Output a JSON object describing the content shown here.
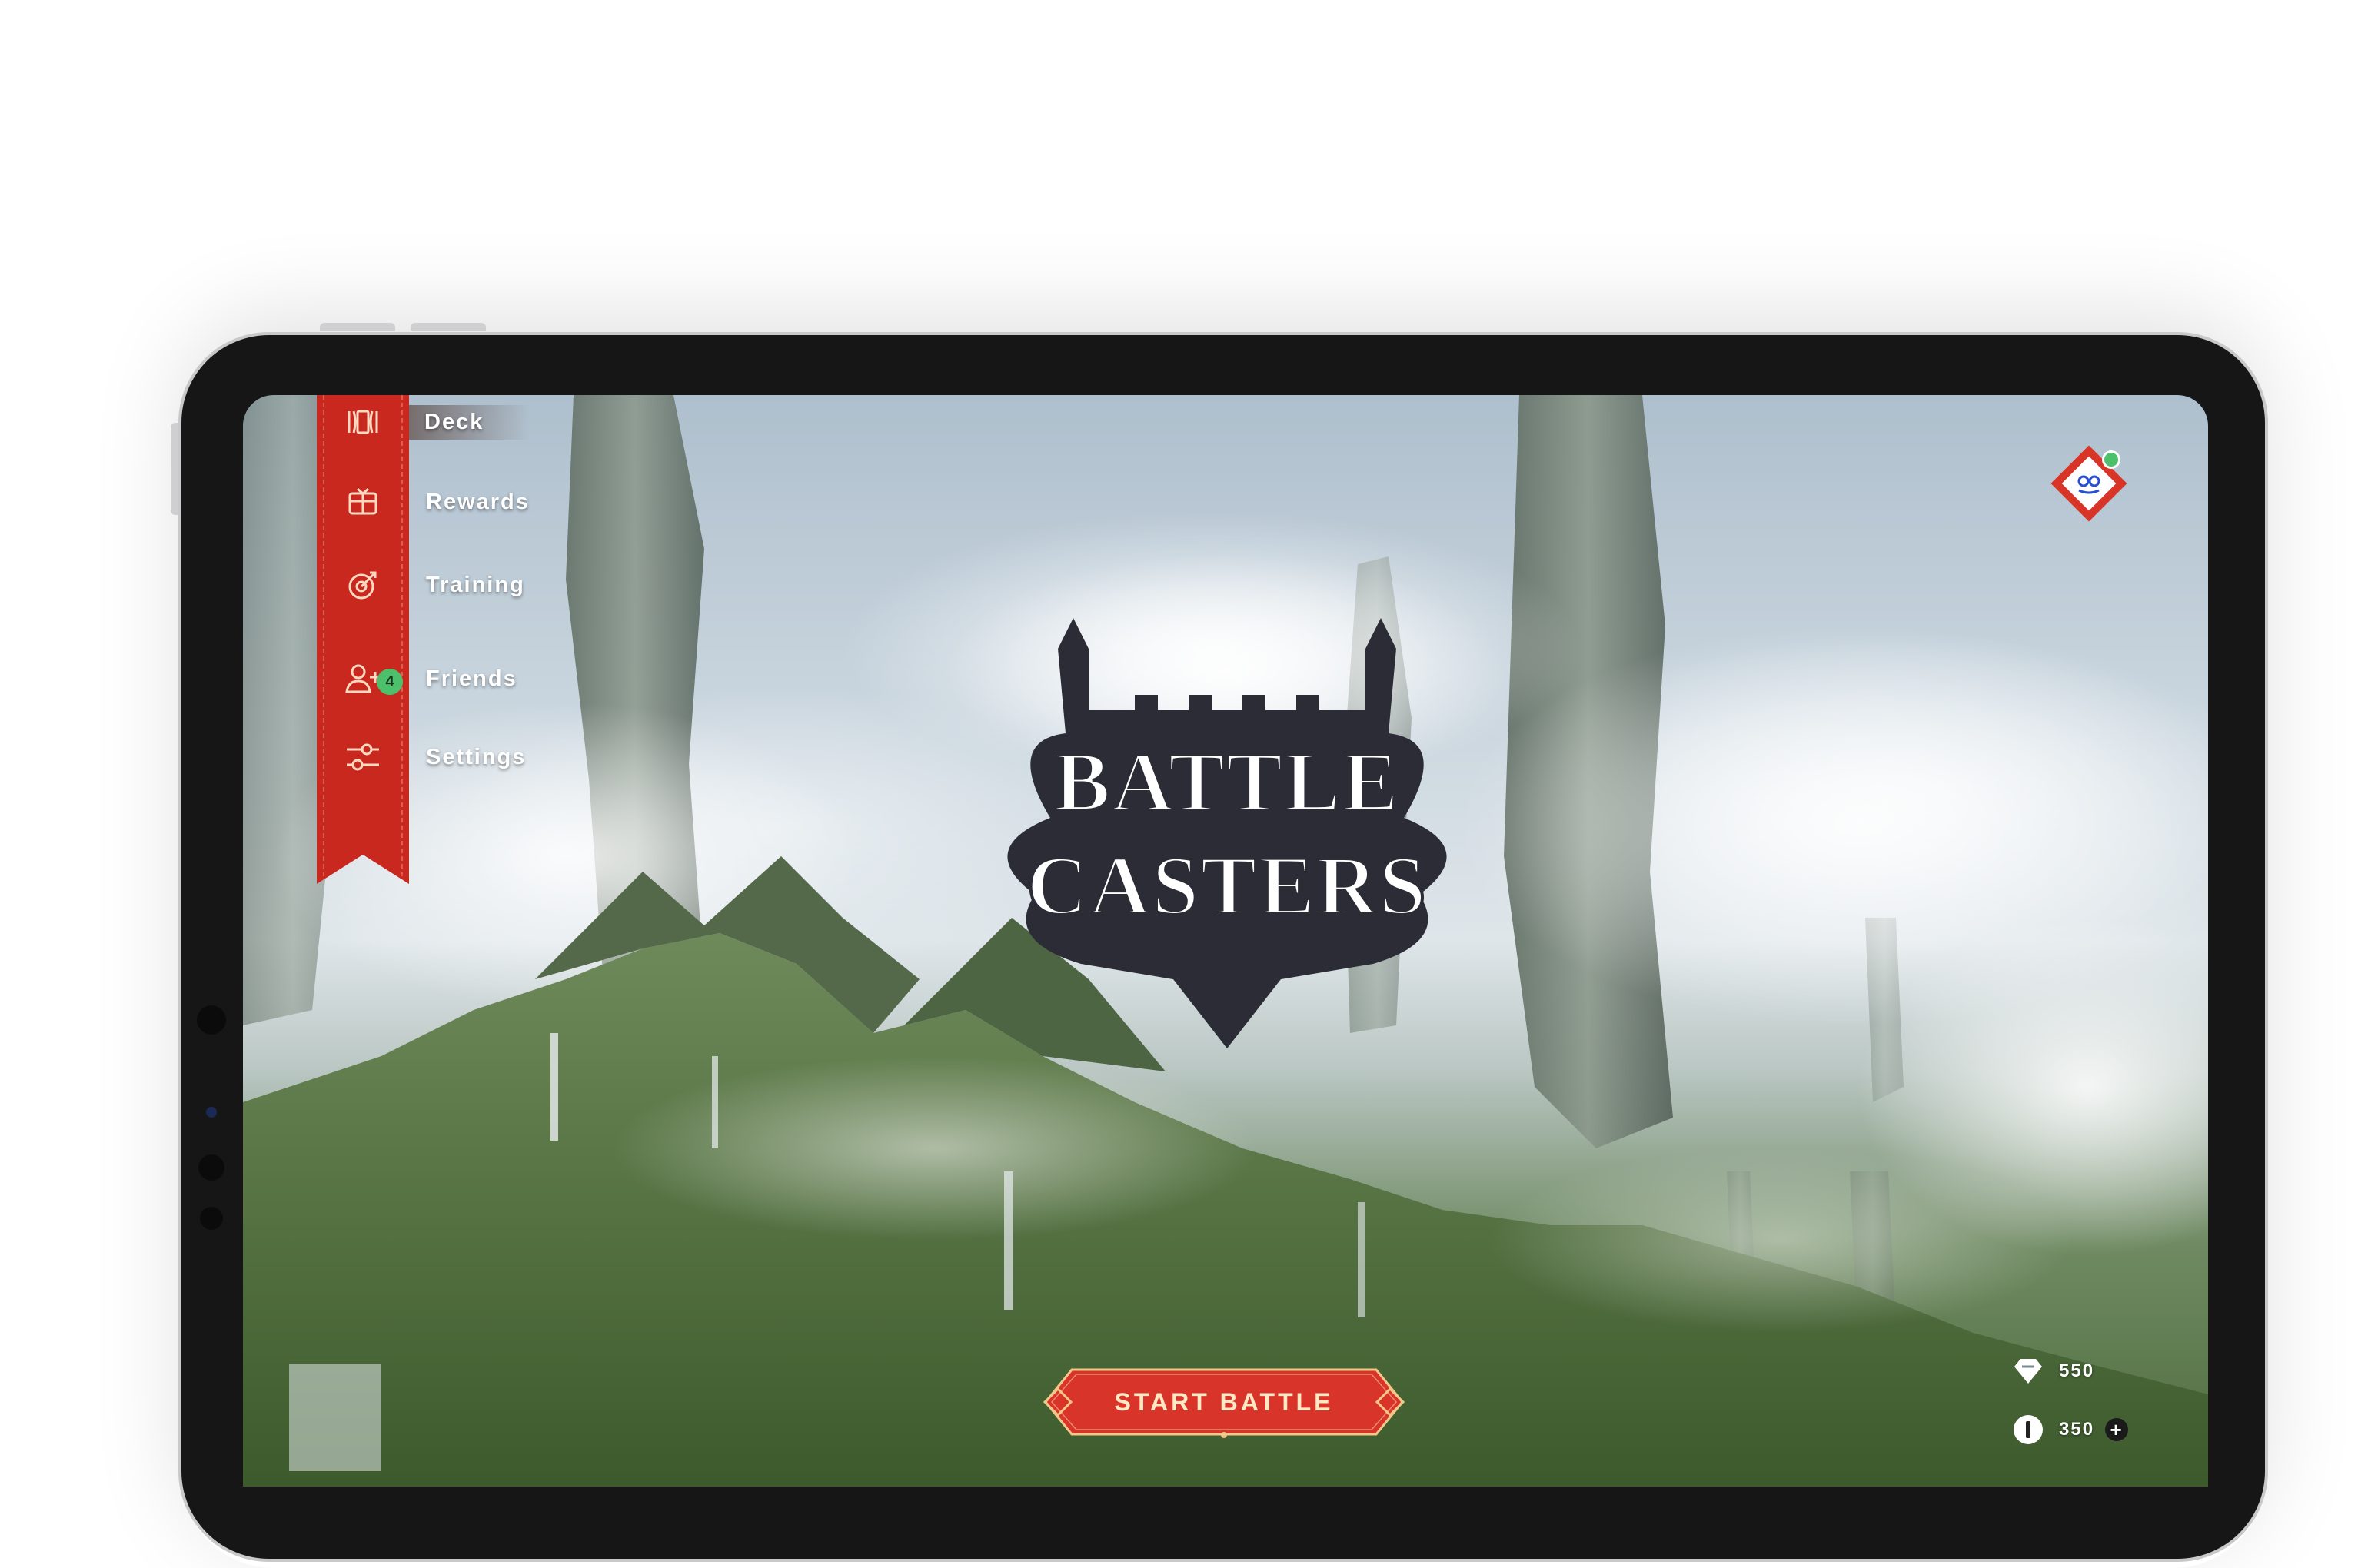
{
  "sidebar": {
    "items": [
      {
        "label": "Deck",
        "icon": "cards-icon"
      },
      {
        "label": "Rewards",
        "icon": "gift-icon"
      },
      {
        "label": "Training",
        "icon": "target-icon"
      },
      {
        "label": "Friends",
        "icon": "add-user-icon",
        "badge": "4"
      },
      {
        "label": "Settings",
        "icon": "sliders-icon"
      }
    ],
    "active_index": 0
  },
  "logo": {
    "line1": "BATTLE",
    "line2": "CASTERS"
  },
  "start_button": {
    "label": "START BATTLE"
  },
  "currency": {
    "gems": "550",
    "coins": "350",
    "plus": "+"
  },
  "colors": {
    "accent": "#c8281e",
    "online": "#4cc06a",
    "logo_fill": "#2c2c36"
  }
}
